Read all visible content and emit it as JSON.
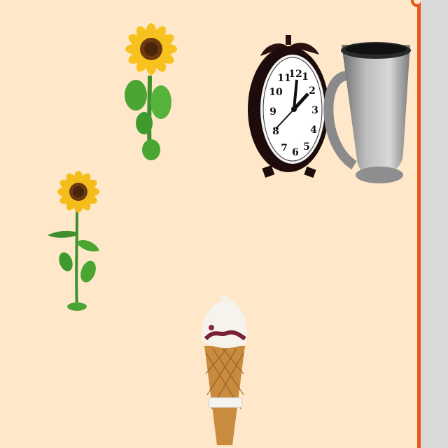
{
  "canvas": {
    "background": "#ffe8c9",
    "stickers": [
      {
        "name": "sunflower-icon",
        "icon": "sunflower"
      },
      {
        "name": "sunflower-icon",
        "icon": "sunflower"
      },
      {
        "name": "alarm-clock-icon",
        "icon": "alarm-clock"
      },
      {
        "name": "mug-icon",
        "icon": "mug"
      },
      {
        "name": "ice-cream-cone-icon",
        "icon": "ice-cream-cone"
      }
    ]
  },
  "divider": {
    "color": "#e8561a"
  },
  "side_panel": {
    "background": "#dadada"
  },
  "clock": {
    "numerals": [
      "12",
      "1",
      "2",
      "3",
      "4",
      "5",
      "6",
      "7",
      "8",
      "9",
      "10",
      "11"
    ]
  }
}
